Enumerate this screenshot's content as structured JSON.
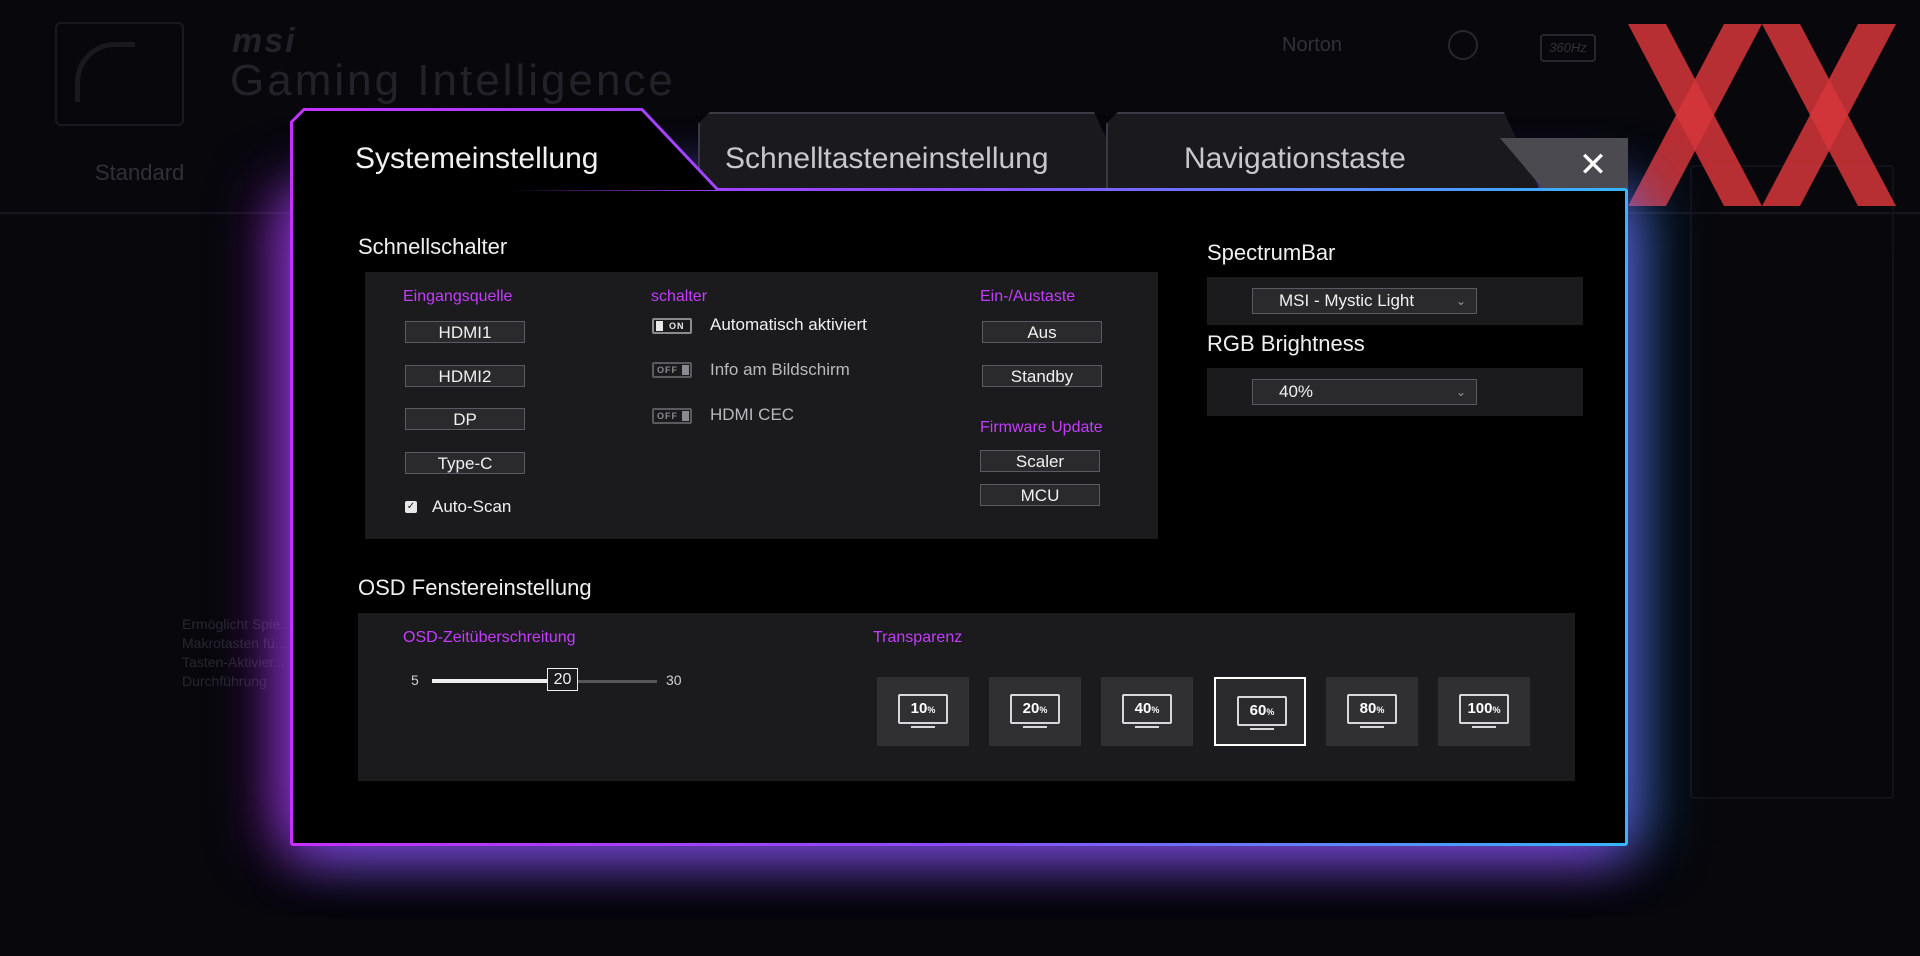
{
  "background": {
    "brand": "msi",
    "subtitle": "Gaming Intelligence",
    "tab_standard": "Standard",
    "top_link": "Norton",
    "refresh_rate": "360Hz",
    "description": "Ermöglicht Spie... Makrotasten fü... Tasten-Aktivier... Durchführung"
  },
  "modal": {
    "tabs": [
      {
        "label": "Systemeinstellung",
        "active": true
      },
      {
        "label": "Schnelltasteneinstellung",
        "active": false
      },
      {
        "label": "Navigationstaste",
        "active": false
      }
    ],
    "close_glyph": "✕"
  },
  "quick_switch": {
    "title": "Schnellschalter",
    "input_source": {
      "label": "Eingangsquelle",
      "buttons": [
        "HDMI1",
        "HDMI2",
        "DP",
        "Type-C"
      ],
      "auto_scan": {
        "label": "Auto-Scan",
        "checked": true
      }
    },
    "switches": {
      "label": "schalter",
      "items": [
        {
          "label": "Automatisch aktiviert",
          "state": "ON"
        },
        {
          "label": "Info am Bildschirm",
          "state": "OFF"
        },
        {
          "label": "HDMI CEC",
          "state": "OFF"
        }
      ]
    },
    "power_key": {
      "label": "Ein-/Austaste",
      "buttons": [
        "Aus",
        "Standby"
      ]
    },
    "firmware": {
      "label": "Firmware Update",
      "buttons": [
        "Scaler",
        "MCU"
      ]
    }
  },
  "spectrum_bar": {
    "title": "SpectrumBar",
    "selected": "MSI - Mystic Light"
  },
  "rgb_brightness": {
    "title": "RGB Brightness",
    "selected": "40%"
  },
  "osd_window": {
    "title": "OSD Fenstereinstellung",
    "timeout": {
      "label": "OSD-Zeitüberschreitung",
      "min": "5",
      "max": "30",
      "value": "20",
      "value_num": 20,
      "min_num": 5,
      "max_num": 30
    },
    "transparency": {
      "label": "Transparenz",
      "options": [
        {
          "value": "10",
          "unit": "%"
        },
        {
          "value": "20",
          "unit": "%"
        },
        {
          "value": "40",
          "unit": "%"
        },
        {
          "value": "60",
          "unit": "%"
        },
        {
          "value": "80",
          "unit": "%"
        },
        {
          "value": "100",
          "unit": "%"
        }
      ],
      "selected": "60"
    }
  },
  "colors": {
    "accent_magenta": "#c33dff",
    "frame_left": "#c530ff",
    "frame_right": "#36b6ff",
    "watermark_red": "#d6353b"
  }
}
